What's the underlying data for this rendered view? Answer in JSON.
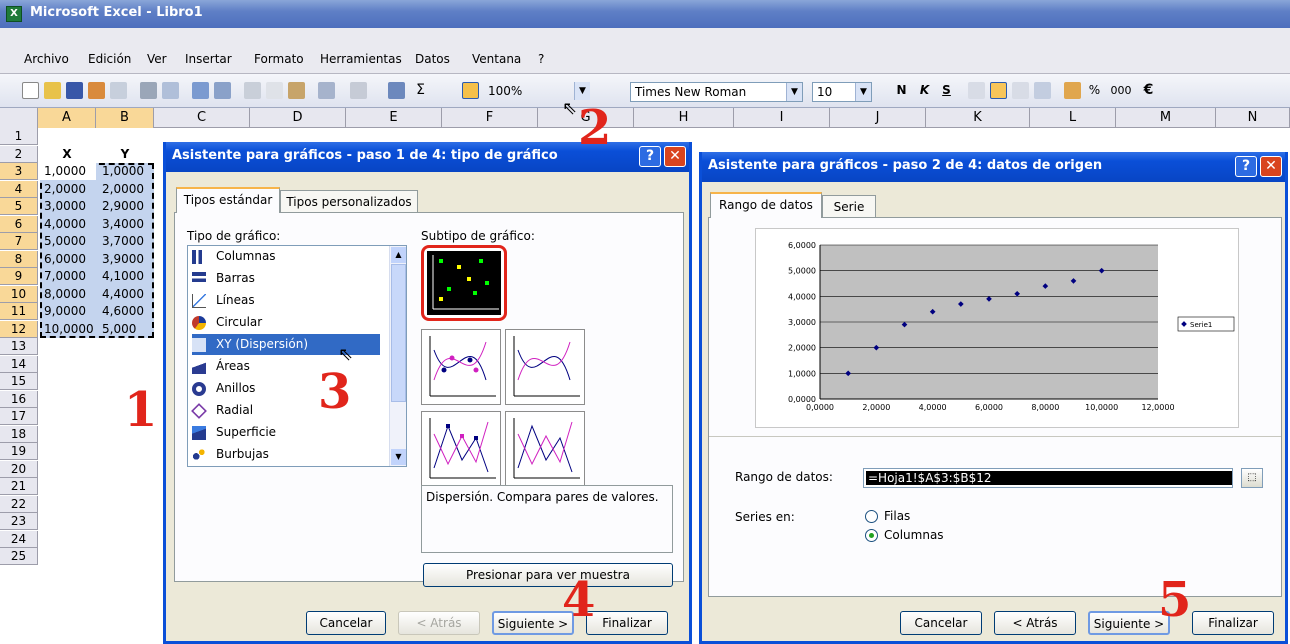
{
  "window": {
    "title": "Microsoft Excel - Libro1"
  },
  "menu": [
    "Archivo",
    "Edición",
    "Ver",
    "Insertar",
    "Formato",
    "Herramientas",
    "Datos",
    "Ventana",
    "?"
  ],
  "toolbar": {
    "zoom": "100%",
    "font": "Times New Roman",
    "size": "10",
    "bold": "N",
    "italic": "K",
    "underline": "S",
    "percent": "%",
    "thousands": "000",
    "euro": "€"
  },
  "sheet": {
    "columns": [
      "A",
      "B",
      "C",
      "D",
      "E",
      "F",
      "G",
      "H",
      "I",
      "J",
      "K",
      "L",
      "M",
      "N"
    ],
    "rows": [
      "1",
      "2",
      "3",
      "4",
      "5",
      "6",
      "7",
      "8",
      "9",
      "10",
      "11",
      "12",
      "13",
      "14",
      "15",
      "16",
      "17",
      "18",
      "19",
      "20",
      "21",
      "22",
      "23",
      "24",
      "25"
    ],
    "header_x": "X",
    "header_y": "Y",
    "data": [
      [
        "1,0000",
        "1,0000"
      ],
      [
        "2,0000",
        "2,0000"
      ],
      [
        "3,0000",
        "2,9000"
      ],
      [
        "4,0000",
        "3,4000"
      ],
      [
        "5,0000",
        "3,7000"
      ],
      [
        "6,0000",
        "3,9000"
      ],
      [
        "7,0000",
        "4,1000"
      ],
      [
        "8,0000",
        "4,4000"
      ],
      [
        "9,0000",
        "4,6000"
      ],
      [
        "10,0000",
        "5,000"
      ]
    ]
  },
  "dialog1": {
    "title": "Asistente para gráficos - paso 1 de 4: tipo de gráfico",
    "tab1": "Tipos estándar",
    "tab2": "Tipos personalizados",
    "type_label": "Tipo de gráfico:",
    "subtype_label": "Subtipo de gráfico:",
    "types": [
      "Columnas",
      "Barras",
      "Líneas",
      "Circular",
      "XY (Dispersión)",
      "Áreas",
      "Anillos",
      "Radial",
      "Superficie",
      "Burbujas"
    ],
    "selected_type": "XY (Dispersión)",
    "description": "Dispersión. Compara pares de valores.",
    "preview_button": "Presionar para ver muestra",
    "cancel": "Cancelar",
    "back": "< Atrás",
    "next": "Siguiente >",
    "finish": "Finalizar"
  },
  "dialog2": {
    "title": "Asistente para gráficos - paso 2 de 4: datos de origen",
    "tab1": "Rango de datos",
    "tab2": "Serie",
    "range_label": "Rango de datos:",
    "range_value": "=Hoja1!$A$3:$B$12",
    "series_label": "Series en:",
    "opt_rows": "Filas",
    "opt_cols": "Columnas",
    "cancel": "Cancelar",
    "back": "< Atrás",
    "next": "Siguiente >",
    "finish": "Finalizar"
  },
  "chart_data": {
    "type": "scatter",
    "x": [
      1,
      2,
      3,
      4,
      5,
      6,
      7,
      8,
      9,
      10
    ],
    "y": [
      1,
      2,
      2.9,
      3.4,
      3.7,
      3.9,
      4.1,
      4.4,
      4.6,
      5
    ],
    "xlim": [
      0,
      12
    ],
    "ylim": [
      0,
      6
    ],
    "xticks": [
      "0,0000",
      "2,0000",
      "4,0000",
      "6,0000",
      "8,0000",
      "10,0000",
      "12,0000"
    ],
    "yticks": [
      "0,0000",
      "1,0000",
      "2,0000",
      "3,0000",
      "4,0000",
      "5,0000",
      "6,0000"
    ],
    "legend": "Serie1",
    "legend_position": "right",
    "grid": true,
    "plot_bg": "#c0c0c0",
    "marker_color": "#000080"
  },
  "annotations": [
    "1",
    "2",
    "3",
    "4",
    "5"
  ]
}
